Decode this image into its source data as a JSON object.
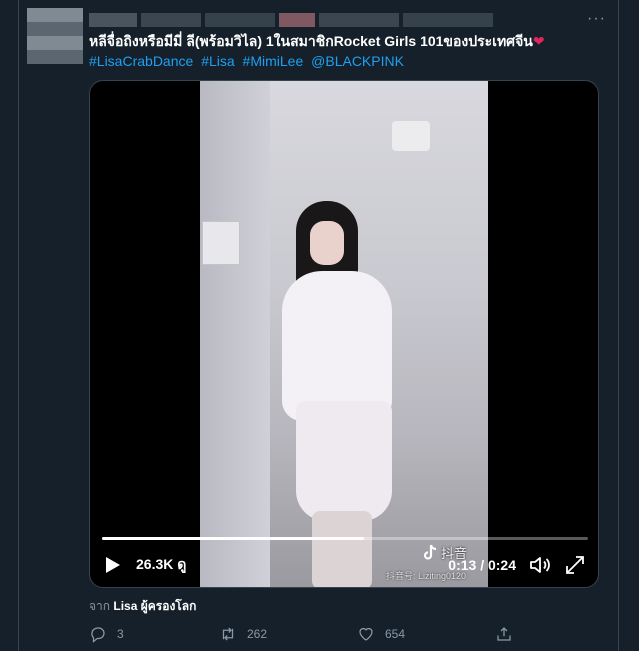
{
  "tweet": {
    "more_label": "···",
    "text": "หลีจื่อถิงหรือมีมี่ ลี(พร้อมวิไล) 1ในสมาชิกRocket Girls 101ของประเทศจีน",
    "hashtags": [
      "#LisaCrabDance",
      "#Lisa",
      "#MimiLee",
      "@BLACKPINK"
    ]
  },
  "video": {
    "views": "26.3K ดู",
    "time": "0:13 / 0:24",
    "progress": 0.54,
    "watermark": "抖音",
    "watermark_id": "抖音号: Liziting0120"
  },
  "source": {
    "prefix": "จาก",
    "name": "Lisa ผู้ครองโลก"
  },
  "actions": {
    "reply_count": "3",
    "retweet_count": "262",
    "like_count": "654"
  },
  "colors": {
    "background": "#15202b",
    "link": "#1da1f2",
    "muted": "#8899a6",
    "heart": "#e0245e"
  },
  "icons": [
    "more-icon",
    "play-icon",
    "volume-icon",
    "fullscreen-icon",
    "reply-icon",
    "retweet-icon",
    "like-icon",
    "share-icon",
    "tiktok-icon"
  ]
}
